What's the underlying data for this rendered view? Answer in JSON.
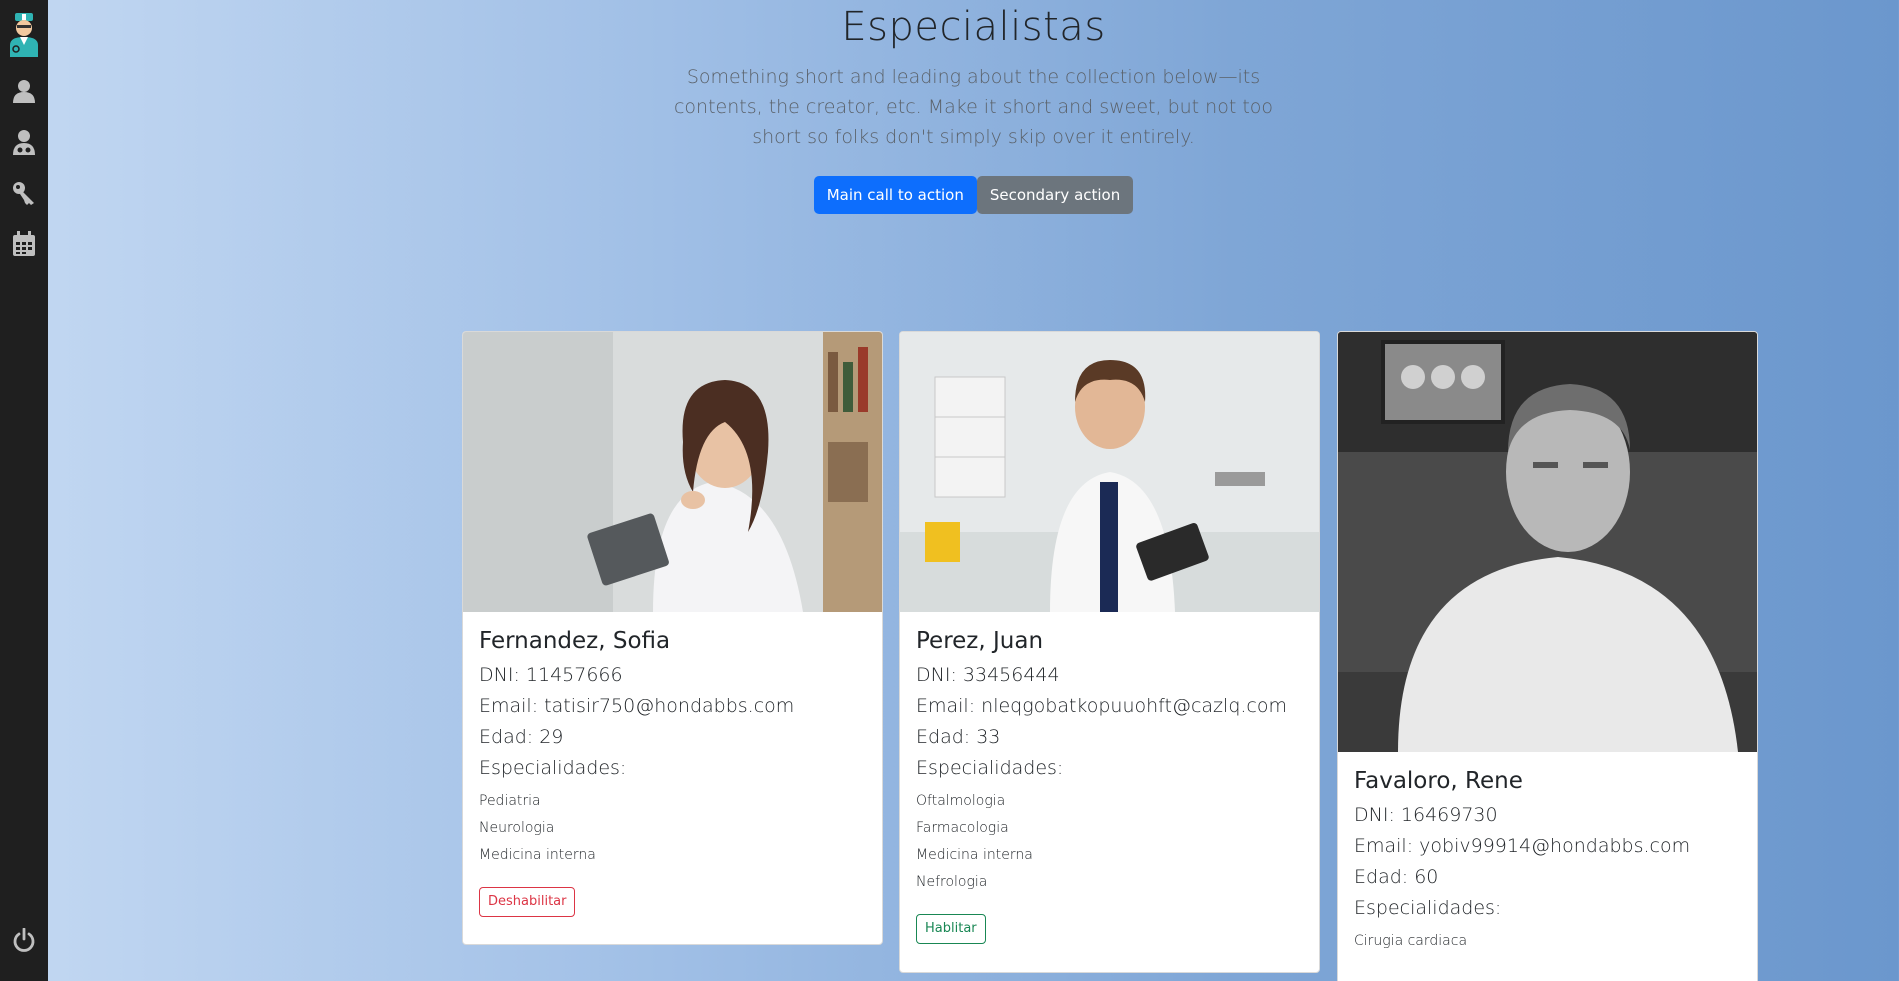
{
  "hero": {
    "title": "Especialistas",
    "description": "Something short and leading about the collection below—its contents, the creator, etc. Make it short and sweet, but not too short so folks don't simply skip over it entirely.",
    "primary_action": "Main call to action",
    "secondary_action": "Secondary action"
  },
  "sidebar": {
    "items": [
      "user-icon",
      "doctor-icon",
      "key-icon",
      "calendar-icon"
    ],
    "bottom": "power-icon"
  },
  "labels": {
    "dni": "DNI: ",
    "email": "Email: ",
    "edad": "Edad: ",
    "especialidades": "Especialidades:"
  },
  "specialists": [
    {
      "name": "Fernandez, Sofia",
      "dni": "11457666",
      "email": "tatisir750@hondabbs.com",
      "edad": "29",
      "especialidades": [
        "Pediatria",
        "Neurologia",
        "Medicina interna"
      ],
      "action": "Deshabilitar"
    },
    {
      "name": "Perez, Juan",
      "dni": "33456444",
      "email": "nleqgobatkopuuohft@cazlq.com",
      "edad": "33",
      "especialidades": [
        "Oftalmologia",
        "Farmacologia",
        "Medicina interna",
        "Nefrologia"
      ],
      "action": "Hablitar"
    },
    {
      "name": "Favaloro, Rene",
      "dni": "16469730",
      "email": "yobiv99914@hondabbs.com",
      "edad": "60",
      "especialidades": [
        "Cirugia cardiaca"
      ]
    }
  ],
  "colors": {
    "primary": "#0d6efd",
    "secondary": "#6c757d",
    "danger": "#dc3545",
    "success": "#198754",
    "sidebar": "#1f1f1f"
  }
}
